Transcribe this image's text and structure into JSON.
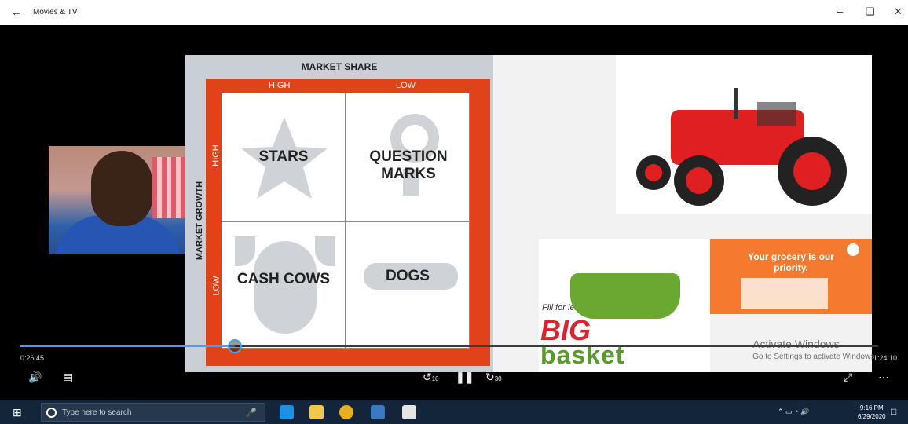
{
  "window": {
    "title": "Movies & TV"
  },
  "slide": {
    "bcg": {
      "top_label": "MARKET SHARE",
      "high_label": "HIGH",
      "low_label": "LOW",
      "side_label": "MARKET GROWTH",
      "side_high": "HIGH",
      "side_low": "LOW",
      "cells": [
        {
          "label": "STARS"
        },
        {
          "label": "QUESTION MARKS"
        },
        {
          "label": "CASH COWS"
        },
        {
          "label": "DOGS"
        }
      ]
    },
    "ad": {
      "headline": "Your grocery is our priority.",
      "tagline": "Fill for less",
      "brand_top": "BIG",
      "brand_bottom": "basket"
    }
  },
  "player": {
    "elapsed": "0:26:45",
    "total": "1:24:10",
    "progress_fraction": 0.25,
    "rewind": "10",
    "forward": "30"
  },
  "watermark": {
    "line1": "Activate Windows",
    "line2": "Go to Settings to activate Windows."
  },
  "taskbar": {
    "search_placeholder": "Type here to search",
    "time": "9:16 PM",
    "date": "6/29/2020"
  },
  "icons": {
    "back": "back-arrow-icon",
    "minimize": "minimize-icon",
    "restore": "restore-icon",
    "close": "close-icon",
    "volume": "volume-icon",
    "subtitles": "subtitles-icon",
    "rewind": "rewind-10-icon",
    "pause": "pause-icon",
    "forward": "forward-30-icon",
    "fullscreen": "fullscreen-icon",
    "more": "more-icon"
  },
  "colors": {
    "bcg_frame": "#e0431a",
    "accent": "#4a9cf0",
    "bigbasket_red": "#d8252f",
    "bigbasket_green": "#5a9a2a",
    "ad_orange": "#f47a30"
  }
}
